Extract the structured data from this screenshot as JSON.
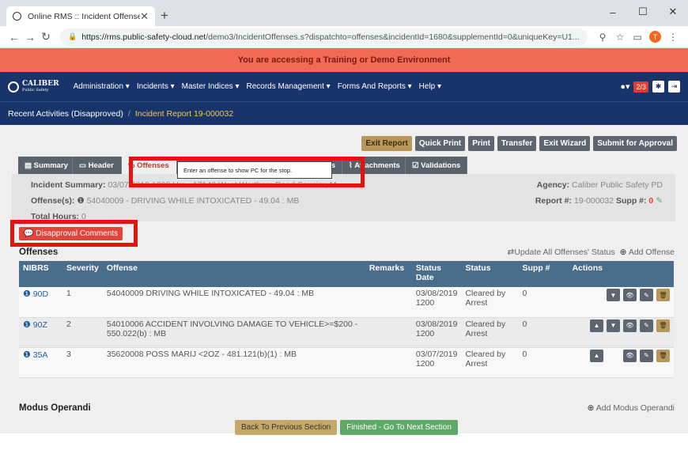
{
  "browser": {
    "tab_title": "Online RMS :: Incident Offenses",
    "url_host": "https://rms.public-safety-cloud.net",
    "url_path": "/demo3/IncidentOffenses.s?dispatchto=offenses&incidentId=1680&supplementId=0&uniqueKey=U1...",
    "profile_initial": "T"
  },
  "banner": {
    "text": "You are accessing a Training or Demo Environment"
  },
  "topnav": {
    "logo": "CALIBER",
    "logo_sub": "Public Safety",
    "menus": [
      "Administration",
      "Incidents",
      "Master Indices",
      "Records Management",
      "Forms And Reports",
      "Help"
    ],
    "counter": "2/3"
  },
  "breadcrumb": {
    "root": "Recent Activities (Disapproved)",
    "current": "Incident Report 19-000032"
  },
  "actions": [
    "Exit Report",
    "Quick Print",
    "Print",
    "Transfer",
    "Exit Wizard",
    "Submit for Approval"
  ],
  "tabs": [
    "Summary",
    "Header",
    "Offenses",
    "",
    "",
    "rratives",
    "Attachments",
    "Validations"
  ],
  "tooltip": "Enter an offense to show PC for the stop.",
  "summary": {
    "incident_label": "Incident Summary:",
    "incident_value": "03/07/2019 1200 Hrs - 17140 West Wortham Road Saucier, M...",
    "offenses_label": "Offense(s):",
    "offenses_value": "54040009 - DRIVING WHILE INTOXICATED - 49.04 : MB",
    "hours_label": "Total Hours:",
    "hours_value": "0",
    "agency_label": "Agency:",
    "agency_value": "Caliber Public Safety PD",
    "report_label": "Report #:",
    "report_value": "19-000032",
    "supp_label": "Supp #:",
    "supp_value": "0"
  },
  "disapproval_button": "Disapproval Comments",
  "offenses": {
    "title": "Offenses",
    "update_link": "Update All Offenses' Status",
    "add_link": "Add Offense",
    "columns": [
      "NIBRS",
      "Severity",
      "Offense",
      "Remarks",
      "Status Date",
      "Status",
      "Supp #",
      "Actions"
    ],
    "rows": [
      {
        "nibrs": "90D",
        "severity": "1",
        "offense": "54040009 DRIVING WHILE INTOXICATED - 49.04 : MB",
        "remarks": "",
        "date": "03/08/2019 1200",
        "status": "Cleared by Arrest",
        "supp": "0"
      },
      {
        "nibrs": "90Z",
        "severity": "2",
        "offense": "54010006 ACCIDENT INVOLVING DAMAGE TO VEHICLE>=$200 - 550.022(b) : MB",
        "remarks": "",
        "date": "03/08/2019 1200",
        "status": "Cleared by Arrest",
        "supp": "0"
      },
      {
        "nibrs": "35A",
        "severity": "3",
        "offense": "35620008 POSS MARIJ <2OZ - 481.121(b)(1) : MB",
        "remarks": "",
        "date": "03/07/2019 1200",
        "status": "Cleared by Arrest",
        "supp": "0"
      }
    ]
  },
  "modus": {
    "title": "Modus Operandi",
    "add_link": "Add Modus Operandi"
  },
  "footer": {
    "back": "Back To Previous Section",
    "next": "Finished - Go To Next Section"
  }
}
